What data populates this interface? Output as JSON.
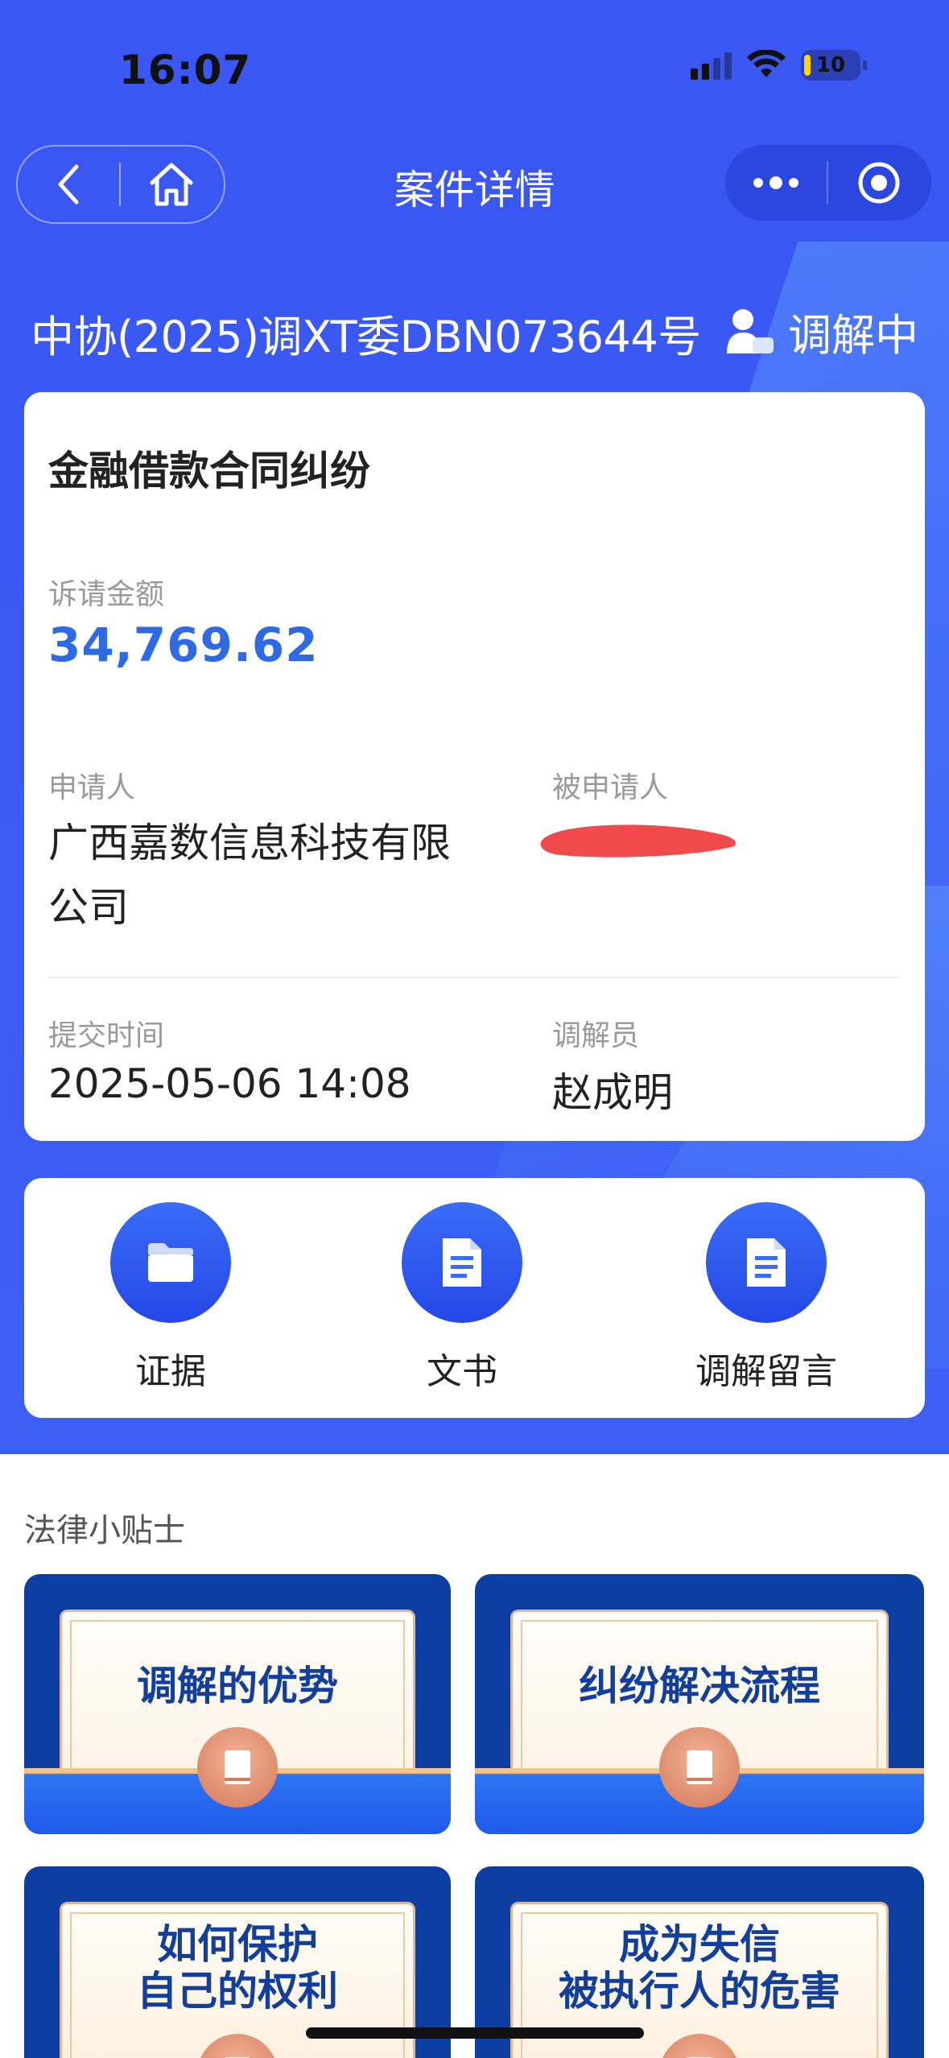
{
  "status_bar": {
    "time": "16:07",
    "battery": "10"
  },
  "nav": {
    "title": "案件详情"
  },
  "case": {
    "number": "中协(2025)调XT委DBN073644号",
    "status": "调解中",
    "type": "金融借款合同纠纷",
    "amount_label": "诉请金额",
    "amount": "34,769.62",
    "applicant_label": "申请人",
    "applicant_line1": "广西嘉数信息科技有限",
    "applicant_line2": "公司",
    "respondent_label": "被申请人",
    "submit_time_label": "提交时间",
    "submit_time": "2025-05-06 14:08",
    "mediator_label": "调解员",
    "mediator": "赵成明"
  },
  "actions": [
    {
      "label": "证据",
      "icon": "folder-icon"
    },
    {
      "label": "文书",
      "icon": "document-icon"
    },
    {
      "label": "调解留言",
      "icon": "message-document-icon"
    }
  ],
  "tips": {
    "title": "法律小贴士",
    "items": [
      {
        "line1": "调解的优势",
        "line2": ""
      },
      {
        "line1": "纠纷解决流程",
        "line2": ""
      },
      {
        "line1": "如何保护",
        "line2": "自己的权利"
      },
      {
        "line1": "成为失信",
        "line2": "被执行人的危害"
      }
    ]
  },
  "colors": {
    "primary": "#3a56f3",
    "amount": "#2f6ae6",
    "tip_bg": "#0d3fa3",
    "redaction": "#f04a4a"
  }
}
